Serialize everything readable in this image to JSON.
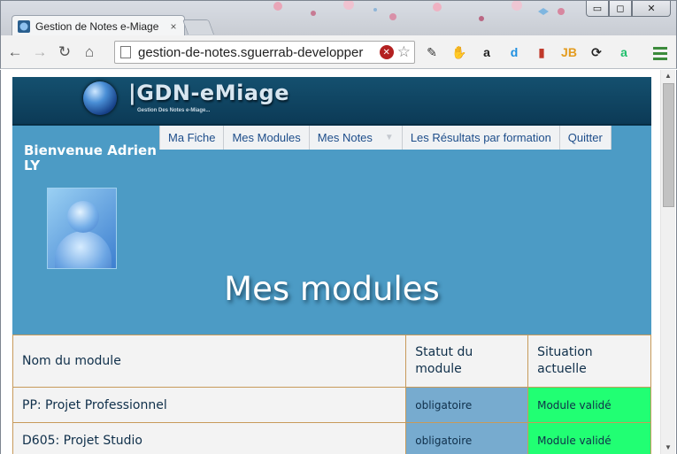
{
  "browser": {
    "tab_title": "Gestion de Notes e-Miage",
    "tab_close": "×",
    "url": "gestion-de-notes.sguerrab-developper",
    "nav": {
      "back": "←",
      "forward": "→",
      "reload": "↻",
      "home": "⌂"
    },
    "star": "☆",
    "extensions": [
      {
        "name": "extension-stylus-icon",
        "glyph": "✎",
        "color": "#333"
      },
      {
        "name": "extension-adblock-icon",
        "glyph": "✋",
        "color": "#d21f1f"
      },
      {
        "name": "extension-amazon-icon",
        "glyph": "a",
        "color": "#222"
      },
      {
        "name": "extension-d-icon",
        "glyph": "d",
        "color": "#1d8fe0"
      },
      {
        "name": "extension-book-icon",
        "glyph": "▮",
        "color": "#c0392b"
      },
      {
        "name": "extension-jb-icon",
        "glyph": "JB",
        "color": "#e39b1d"
      },
      {
        "name": "extension-sync-icon",
        "glyph": "⟳",
        "color": "#222"
      },
      {
        "name": "extension-a-icon",
        "glyph": "a",
        "color": "#1fbf6b"
      }
    ],
    "window_controls": {
      "minimize": "▭",
      "maximize": "◻",
      "close": "✕"
    }
  },
  "site": {
    "logo": {
      "title": "|GDN-eMiage",
      "subtitle": "Gestion Des Notes e-Miage..."
    },
    "nav": [
      {
        "label": "Ma Fiche"
      },
      {
        "label": "Mes Modules"
      },
      {
        "label": "Mes Notes",
        "dropdown": true
      },
      {
        "label": "Les Résultats par formation"
      },
      {
        "label": "Quitter"
      }
    ],
    "welcome": "Bienvenue Adrien LY",
    "page_title": "Mes modules",
    "table": {
      "headers": [
        "Nom du module",
        "Statut du module",
        "Situation actuelle"
      ],
      "rows": [
        {
          "name": "PP: Projet Professionnel",
          "status": "obligatoire",
          "situation": "Module validé"
        },
        {
          "name": "D605: Projet Studio",
          "status": "obligatoire",
          "situation": "Module validé"
        }
      ]
    }
  },
  "colors": {
    "header_bg": "#0c3a56",
    "hero_bg": "#4c9bc5",
    "status_bg": "#77abcf",
    "validated_bg": "#21ff73",
    "table_border": "#c79a5a"
  }
}
